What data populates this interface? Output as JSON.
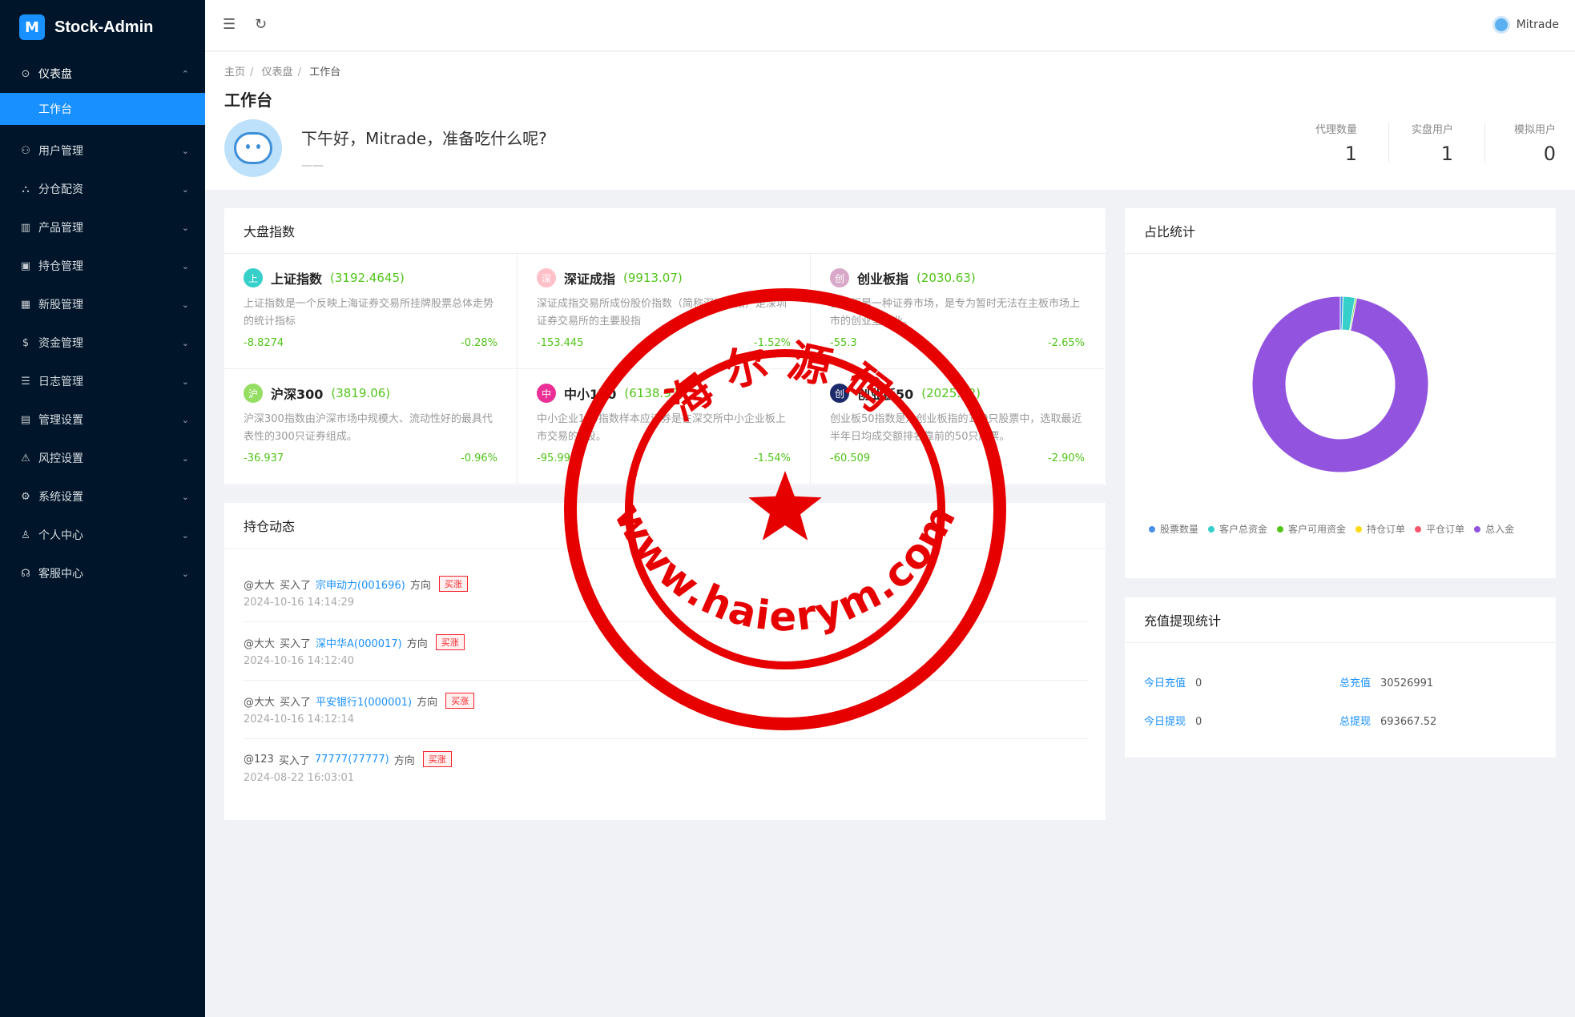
{
  "app": {
    "name": "Stock-Admin",
    "logo_glyph": "M"
  },
  "sidebar": {
    "items": [
      {
        "label": "仪表盘",
        "icon": "dashboard-icon",
        "glyph": "⊙",
        "open": true,
        "children": [
          {
            "label": "工作台",
            "active": true
          }
        ]
      },
      {
        "label": "用户管理",
        "icon": "users-icon",
        "glyph": "⚇"
      },
      {
        "label": "分仓配资",
        "icon": "cluster-icon",
        "glyph": "⛬"
      },
      {
        "label": "产品管理",
        "icon": "chart-icon",
        "glyph": "▥"
      },
      {
        "label": "持仓管理",
        "icon": "position-icon",
        "glyph": "▣"
      },
      {
        "label": "新股管理",
        "icon": "barcode-icon",
        "glyph": "▦"
      },
      {
        "label": "资金管理",
        "icon": "money-icon",
        "glyph": "$"
      },
      {
        "label": "日志管理",
        "icon": "log-icon",
        "glyph": "☰"
      },
      {
        "label": "管理设置",
        "icon": "admin-icon",
        "glyph": "▤"
      },
      {
        "label": "风控设置",
        "icon": "warning-icon",
        "glyph": "⚠"
      },
      {
        "label": "系统设置",
        "icon": "gear-icon",
        "glyph": "⚙"
      },
      {
        "label": "个人中心",
        "icon": "user-icon",
        "glyph": "♙"
      },
      {
        "label": "客服中心",
        "icon": "headset-icon",
        "glyph": "☊"
      }
    ]
  },
  "topbar": {
    "username": "Mitrade"
  },
  "breadcrumb": [
    "主页",
    "仪表盘",
    "工作台"
  ],
  "page_title": "工作台",
  "welcome": {
    "text": "下午好，Mitrade，准备吃什么呢?",
    "sub": "——"
  },
  "stats": [
    {
      "label": "代理数量",
      "value": "1"
    },
    {
      "label": "实盘用户",
      "value": "1"
    },
    {
      "label": "模拟用户",
      "value": "0"
    }
  ],
  "market": {
    "title": "大盘指数",
    "indices": [
      {
        "badge": "上",
        "color": "#36cfc9",
        "name": "上证指数",
        "value": "(3192.4645)",
        "desc": "上证指数是一个反映上海证券交易所挂牌股票总体走势的统计指标",
        "change": "-8.8274",
        "pct": "-0.28%"
      },
      {
        "badge": "深",
        "color": "#ffc0c8",
        "name": "深证成指",
        "value": "(9913.07)",
        "desc": "深证成指交易所成份股价指数（简称深证成指）是深圳证券交易所的主要股指",
        "change": "-153.445",
        "pct": "-1.52%"
      },
      {
        "badge": "创",
        "color": "#d8a8c8",
        "name": "创业板指",
        "value": "(2030.63)",
        "desc": "创业板是一种证券市场，是专为暂时无法在主板市场上市的创业型企业。",
        "change": "-55.3",
        "pct": "-2.65%"
      },
      {
        "badge": "沪",
        "color": "#95de64",
        "name": "沪深300",
        "value": "(3819.06)",
        "desc": "沪深300指数由沪深市场中规模大、流动性好的最具代表性的300只证券组成。",
        "change": "-36.937",
        "pct": "-0.96%"
      },
      {
        "badge": "中",
        "color": "#eb2f96",
        "name": "中小100",
        "value": "(6138.97)",
        "desc": "中小企业100指数样本应证券是在深交所中小企业板上市交易的A股。",
        "change": "-95.99",
        "pct": "-1.54%"
      },
      {
        "badge": "创",
        "color": "#1d2b6b",
        "name": "创业板50",
        "value": "(2025.82)",
        "desc": "创业板50指数是从创业板指的100只股票中，选取最近半年日均成交额排名靠前的50只股票。",
        "change": "-60.509",
        "pct": "-2.90%"
      }
    ]
  },
  "positions": {
    "title": "持仓动态",
    "items": [
      {
        "user": "@大大",
        "verb": "买入了",
        "stock": "宗申动力(001696)",
        "dir_label": "方向",
        "tag": "买涨",
        "time": "2024-10-16 14:14:29"
      },
      {
        "user": "@大大",
        "verb": "买入了",
        "stock": "深中华A(000017)",
        "dir_label": "方向",
        "tag": "买涨",
        "time": "2024-10-16 14:12:40"
      },
      {
        "user": "@大大",
        "verb": "买入了",
        "stock": "平安银行1(000001)",
        "dir_label": "方向",
        "tag": "买涨",
        "time": "2024-10-16 14:12:14"
      },
      {
        "user": "@123",
        "verb": "买入了",
        "stock": "77777(77777)",
        "dir_label": "方向",
        "tag": "买涨",
        "time": "2024-08-22 16:03:01"
      }
    ]
  },
  "ratio": {
    "title": "占比统计",
    "legend": [
      {
        "label": "股票数量",
        "color": "#4a90e2"
      },
      {
        "label": "客户总资金",
        "color": "#36cfc9"
      },
      {
        "label": "客户可用资金",
        "color": "#52c41a"
      },
      {
        "label": "持仓订单",
        "color": "#fadb14"
      },
      {
        "label": "平仓订单",
        "color": "#f5576c"
      },
      {
        "label": "总入金",
        "color": "#9254de"
      }
    ]
  },
  "chart_data": {
    "type": "pie",
    "donut": true,
    "categories": [
      "股票数量",
      "客户总资金",
      "客户可用资金",
      "持仓订单",
      "平仓订单",
      "总入金"
    ],
    "values": [
      0.5,
      2.2,
      0.3,
      0,
      0,
      97
    ]
  },
  "cash": {
    "title": "充值提现统计",
    "rows": [
      {
        "k": "今日充值",
        "v": "0"
      },
      {
        "k": "总充值",
        "v": "30526991"
      },
      {
        "k": "今日提现",
        "v": "0"
      },
      {
        "k": "总提现",
        "v": "693667.52"
      }
    ]
  },
  "stamp": {
    "top_text": "海尔源码",
    "bottom_text": "www.haierym.com",
    "color": "#e60000"
  }
}
